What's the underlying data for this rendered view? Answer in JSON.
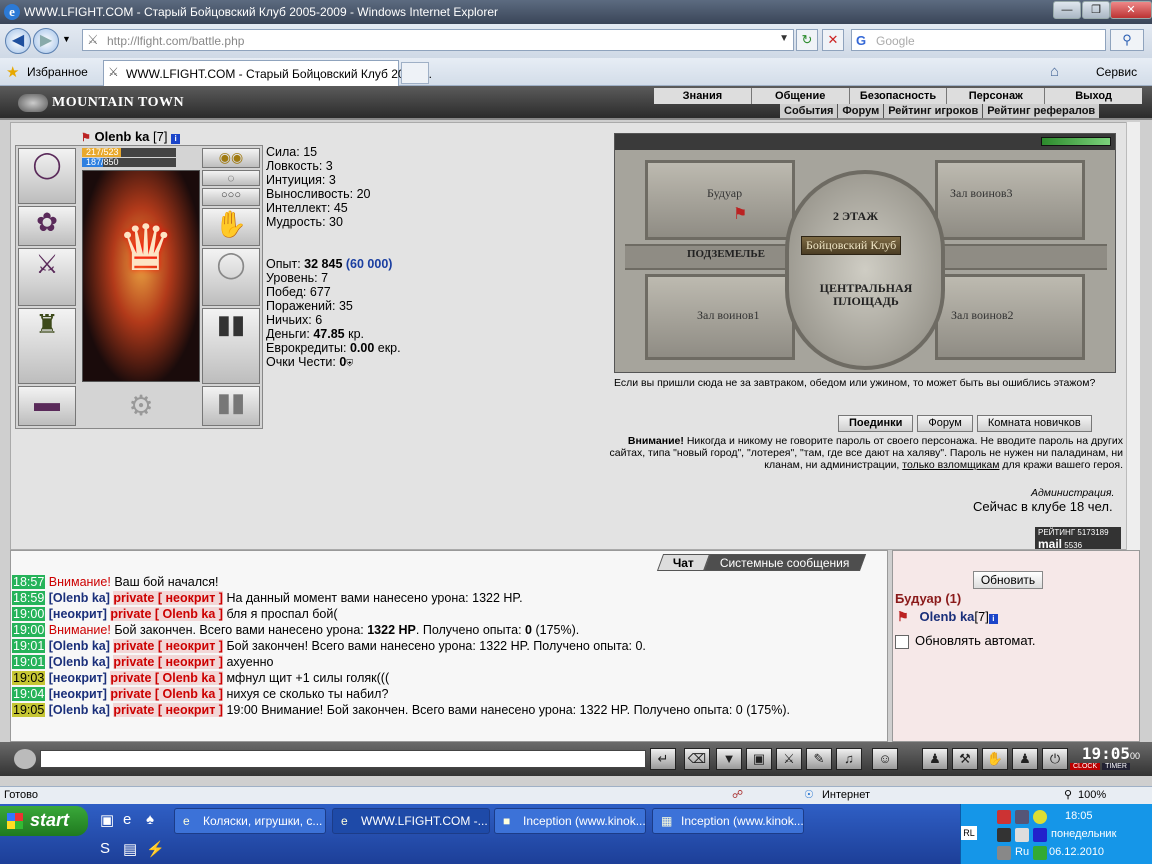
{
  "window": {
    "title": "WWW.LFIGHT.COM - Старый Бойцовский Клуб 2005-2009 - Windows Internet Explorer",
    "url": "http://lfight.com/battle.php",
    "search_placeholder": "Google",
    "favorites_label": "Избранное",
    "tab_label": "WWW.LFIGHT.COM - Старый Бойцовский Клуб 2005-...",
    "service_label": "Сервис",
    "status_ready": "Готово",
    "status_zone": "Интернет",
    "zoom": "100%"
  },
  "game": {
    "logo": "MOUNTAIN TOWN",
    "menu_top": [
      "Знания",
      "Общение",
      "Безопасность",
      "Персонаж",
      "Выход"
    ],
    "menu_sub": [
      "События",
      "Форум",
      "Рейтинг игроков",
      "Рейтинг рефералов"
    ],
    "character": {
      "name": "Olenb ka",
      "level": "[7]",
      "hp": "217/523",
      "hp_fraction": 0.415,
      "mp": "187/850",
      "mp_fraction": 0.22,
      "stats": [
        "Сила: 15",
        "Ловкость: 3",
        "Интуиция: 3",
        "Выносливость: 20",
        "Интеллект: 45",
        "Мудрость: 30"
      ],
      "exp_label": "Опыт:",
      "exp_value": "32 845",
      "exp_next": "(60 000)",
      "level_line": "Уровень: 7",
      "wins": "Побед: 677",
      "losses": "Поражений: 35",
      "draws": "Ничьих: 6",
      "money_label": "Деньги:",
      "money_value": "47.85",
      "money_unit": "кр.",
      "euro_label": "Еврокредиты:",
      "euro_value": "0.00",
      "euro_unit": "екр.",
      "honor_label": "Очки Чести:",
      "honor_value": "0"
    },
    "map": {
      "rooms": [
        "Будуар",
        "Зал воинов3",
        "2 ЭТАЖ",
        "Бойцовский Клуб",
        "ПОДЗЕМЕЛЬЕ",
        "ЦЕНТРАЛЬНАЯ ПЛОЩАДЬ",
        "Зал воинов1",
        "Зал воинов2"
      ],
      "note": "Если вы пришли сюда не за завтраком, обедом или ужином, то может быть вы ошиблись этажом?"
    },
    "buttons": [
      "Поединки",
      "Форум",
      "Комната новичков"
    ],
    "warning": {
      "title": "Внимание!",
      "text": "Никогда и никому не говорите пароль от своего персонажа. Не вводите пароль на других сайтах, типа \"новый город\", \"лотерея\", \"там, где все дают на халяву\". Пароль не нужен ни паладинам, ни кланам, ни администрации,",
      "link": "только взломщикам",
      "tail": "для кражи вашего героя.",
      "admin": "Администрация."
    },
    "online": "Сейчас в клубе 18 чел.",
    "rating_label": "РЕЙТИНГ",
    "rating_values": [
      "5173189",
      "5536"
    ],
    "mail_label": "mail"
  },
  "chat": {
    "tabs": [
      "Чат",
      "Системные сообщения"
    ],
    "lines": [
      {
        "time": "18:57",
        "kind": "sys",
        "warn": "Внимание!",
        "text": "Ваш бой начался!"
      },
      {
        "time": "18:59",
        "kind": "sysnick",
        "nick": "[Olenb ka]",
        "priv": "private [ неокрит ]",
        "text": "На данный момент вами нанесено урона: 1322 HP."
      },
      {
        "time": "19:00",
        "kind": "msg",
        "nick": "[неокрит]",
        "priv": "private [ Olenb ka ]",
        "text": "бля я проспал бой("
      },
      {
        "time": "19:00",
        "kind": "end",
        "warn": "Внимание!",
        "text": "Бой закончен. Всего вами нанесено урона:",
        "b1": "1322 HP",
        "text2": ". Получено опыта:",
        "b2": "0",
        "text3": "(175%)."
      },
      {
        "time": "19:01",
        "kind": "msg",
        "nick": "[Olenb ka]",
        "priv": "private [ неокрит ]",
        "text": "Бой закончен! Всего вами нанесено урона: 1322 HP. Получено опыта: 0."
      },
      {
        "time": "19:01",
        "kind": "msg",
        "nick": "[Olenb ka]",
        "priv": "private [ неокрит ]",
        "text": "ахуенно"
      },
      {
        "time": "19:03",
        "kind": "msg",
        "nick": "[неокрит]",
        "priv": "private [ Olenb ka ]",
        "text": "мфнул щит +1 силы голяк((("
      },
      {
        "time": "19:04",
        "kind": "msg",
        "nick": "[неокрит]",
        "priv": "private [ Olenb ka ]",
        "text": "нихуя се сколько ты набил?"
      },
      {
        "time": "19:05",
        "kind": "msg",
        "nick": "[Olenb ka]",
        "priv": "private [ неокрит ]",
        "text": "19:00 Внимание! Бой закончен. Всего вами нанесено урона: 1322 HP. Получено опыта: 0 (175%)."
      }
    ]
  },
  "room": {
    "refresh_label": "Обновить",
    "title": "Будуар (1)",
    "user": "Olenb ka",
    "user_level": "[7]",
    "auto_label": "Обновлять автомат."
  },
  "clock": {
    "time": "19:05",
    "sec": "00",
    "clock_label": "CLOCK",
    "timer_label": "TIMER"
  },
  "taskbar": {
    "start": "start",
    "items": [
      "Коляски, игрушки, с...",
      "WWW.LFIGHT.COM -...",
      "Inception (www.kinok...",
      "Inception (www.kinok..."
    ],
    "lang": "RL",
    "time": "18:05",
    "day": "понедельник",
    "date": "06.12.2010",
    "lang2": "Ru"
  },
  "colors": {
    "title_bg": "#3a4558",
    "game_bg": "#cfcfcf",
    "time_bg": "#26b35a",
    "private": "#c00000",
    "nick": "#1a2f7a"
  }
}
